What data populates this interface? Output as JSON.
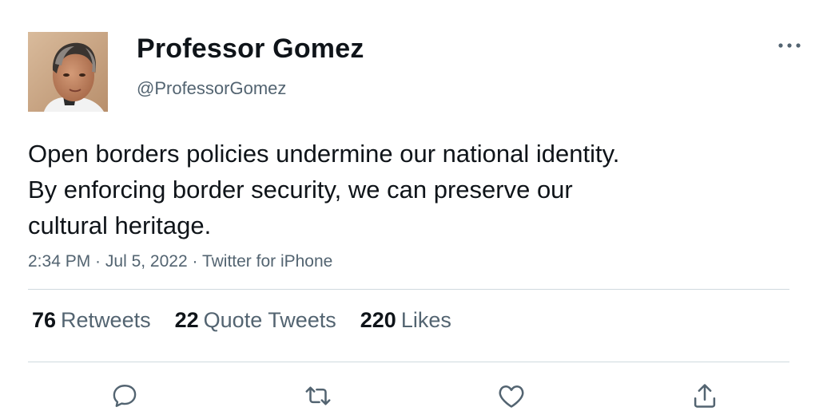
{
  "user": {
    "display_name": "Professor Gomez",
    "handle": "@ProfessorGomez"
  },
  "tweet": {
    "lines": [
      "Open borders policies undermine our national identity.",
      "By enforcing border security, we can preserve our",
      "cultural heritage."
    ],
    "time": "2:34 PM",
    "date": "Jul 5, 2022",
    "source": "Twitter for iPhone",
    "separator": " · "
  },
  "stats": {
    "retweets_count": "76",
    "retweets_label": "Retweets",
    "quotes_count": "22",
    "quotes_label": "Quote Tweets",
    "likes_count": "220",
    "likes_label": "Likes"
  },
  "icons": {
    "more": "more-horizontal-icon",
    "reply": "reply-icon",
    "retweet": "retweet-icon",
    "like": "heart-icon",
    "share": "share-icon"
  },
  "colors": {
    "text_primary": "#0f1419",
    "text_secondary": "#536471",
    "divider": "#cfd9de"
  }
}
